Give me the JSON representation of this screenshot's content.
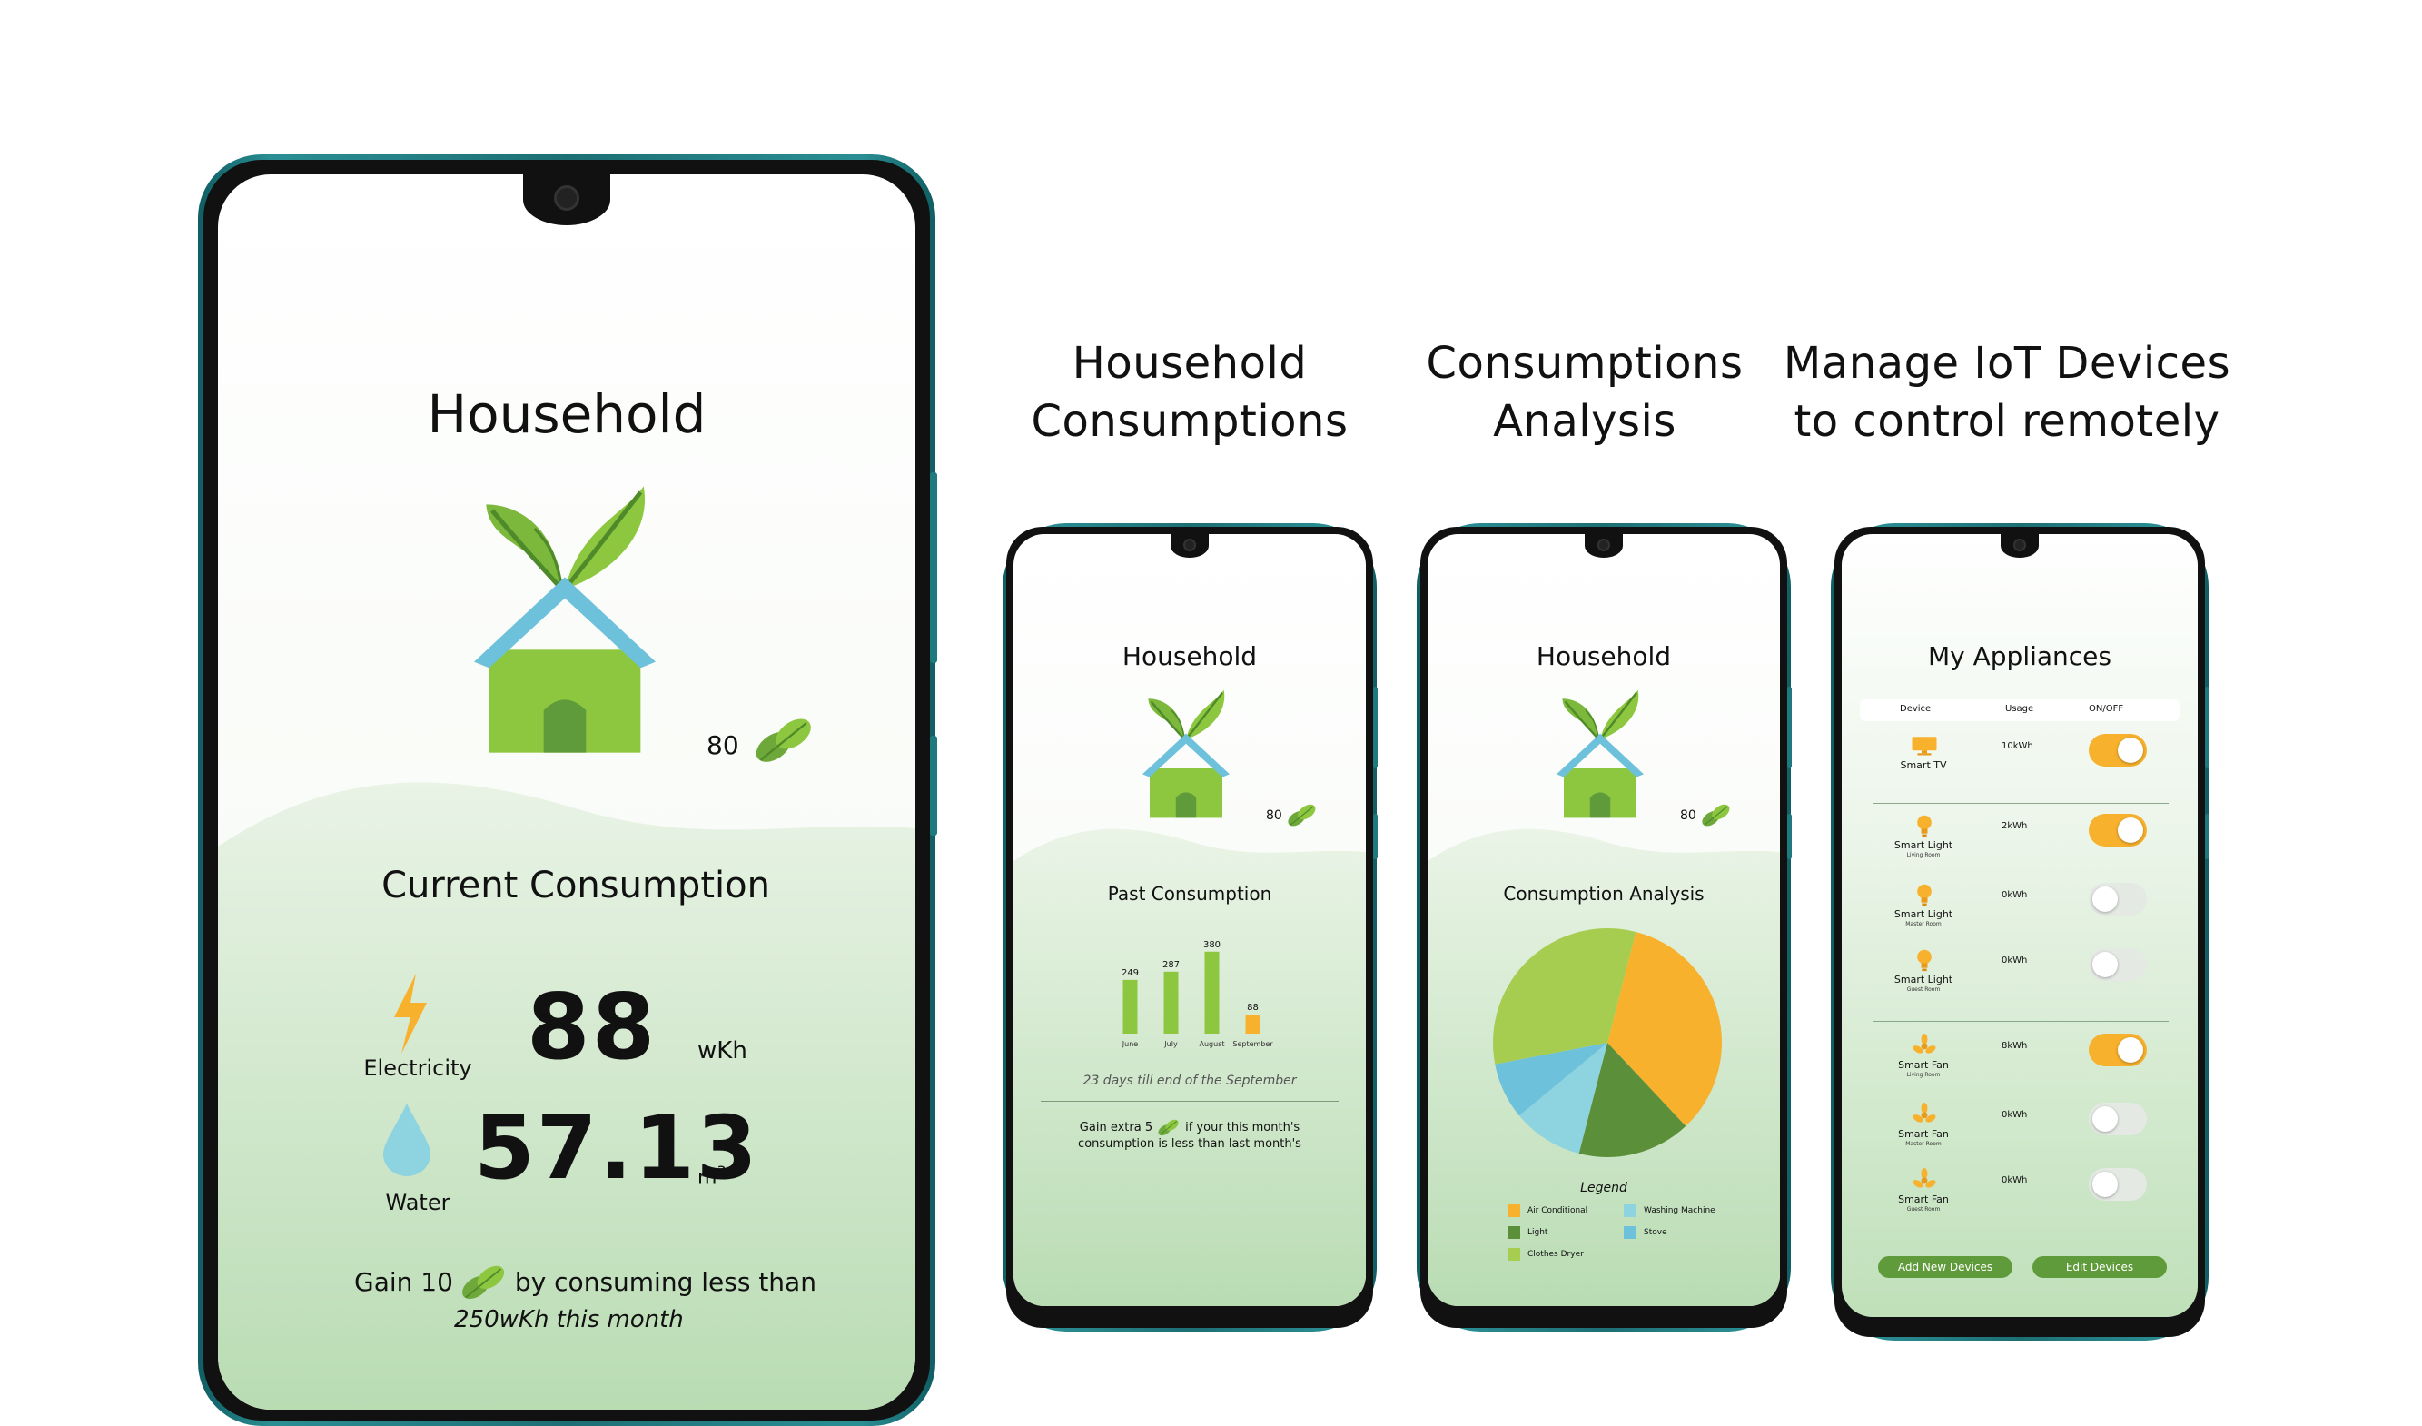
{
  "captions": {
    "c1_line1": "Household",
    "c1_line2": "Consumptions",
    "c2_line1": "Consumptions",
    "c2_line2": "Analysis",
    "c3_line1": "Manage IoT Devices",
    "c3_line2": "to control remotely"
  },
  "big_phone": {
    "title": "Household",
    "points": "80",
    "section_title": "Current Consumption",
    "electricity_label": "Electricity",
    "electricity_value": "88",
    "electricity_unit": "wKh",
    "water_label": "Water",
    "water_value": "57.13",
    "water_unit": "m",
    "water_unit_sup": "3",
    "gain_prefix": "Gain 10",
    "gain_suffix": "by consuming less than",
    "gain_line2": "250wKh this month"
  },
  "phone_past": {
    "title": "Household",
    "points": "80",
    "section_title": "Past Consumption",
    "note": "23 days till end of the September",
    "gain_prefix": "Gain extra 5",
    "gain_suffix": "if your this month's",
    "gain_line2": "consumption is less than last month's"
  },
  "phone_analysis": {
    "title": "Household",
    "points": "80",
    "section_title": "Consumption Analysis",
    "legend_title": "Legend",
    "legend": [
      {
        "label": "Air Conditional",
        "color": "#f7b12d"
      },
      {
        "label": "Washing Machine",
        "color": "#8dd3e0"
      },
      {
        "label": "Light",
        "color": "#5c8f3a"
      },
      {
        "label": "Stove",
        "color": "#6ec1db"
      },
      {
        "label": "Clothes Dryer",
        "color": "#a6cd4f"
      }
    ]
  },
  "phone_appliances": {
    "title": "My Appliances",
    "col_device": "Device",
    "col_usage": "Usage",
    "col_onoff": "ON/OFF",
    "devices": [
      {
        "name": "Smart TV",
        "room": "",
        "usage": "10kWh",
        "on": true,
        "icon": "tv-icon"
      },
      {
        "name": "Smart Light",
        "room": "Living Room",
        "usage": "2kWh",
        "on": true,
        "icon": "bulb-icon"
      },
      {
        "name": "Smart Light",
        "room": "Master Room",
        "usage": "0kWh",
        "on": false,
        "icon": "bulb-icon"
      },
      {
        "name": "Smart Light",
        "room": "Guest Room",
        "usage": "0kWh",
        "on": false,
        "icon": "bulb-icon"
      },
      {
        "name": "Smart Fan",
        "room": "Living Room",
        "usage": "8kWh",
        "on": true,
        "icon": "fan-icon"
      },
      {
        "name": "Smart Fan",
        "room": "Master Room",
        "usage": "0kWh",
        "on": false,
        "icon": "fan-icon"
      },
      {
        "name": "Smart Fan",
        "room": "Guest Room",
        "usage": "0kWh",
        "on": false,
        "icon": "fan-icon"
      }
    ],
    "add_button": "Add New Devices",
    "edit_button": "Edit Devices"
  },
  "chart_data": [
    {
      "type": "bar",
      "categories": [
        "June",
        "July",
        "August",
        "September"
      ],
      "values": [
        249,
        287,
        380,
        88
      ],
      "colors": [
        "#8dc63f",
        "#8dc63f",
        "#8dc63f",
        "#f7b12d"
      ],
      "title": "Past Consumption",
      "xlabel": "",
      "ylabel": "",
      "ylim": [
        0,
        400
      ],
      "grid": false
    },
    {
      "type": "pie",
      "title": "Consumption Analysis",
      "categories": [
        "Air Conditional",
        "Light",
        "Washing Machine",
        "Stove",
        "Clothes Dryer"
      ],
      "values": [
        34,
        16,
        10,
        8,
        32
      ],
      "colors": [
        "#f7b12d",
        "#5c8f3a",
        "#8dd3e0",
        "#6ec1db",
        "#a6cd4f"
      ],
      "legend": "bottom"
    }
  ],
  "colors": {
    "accent_green": "#8dc63f",
    "dark_green": "#5f9b3a",
    "orange": "#f7b12d",
    "roof_blue": "#6ec1db",
    "screen_bottom": "#cde5c8"
  }
}
